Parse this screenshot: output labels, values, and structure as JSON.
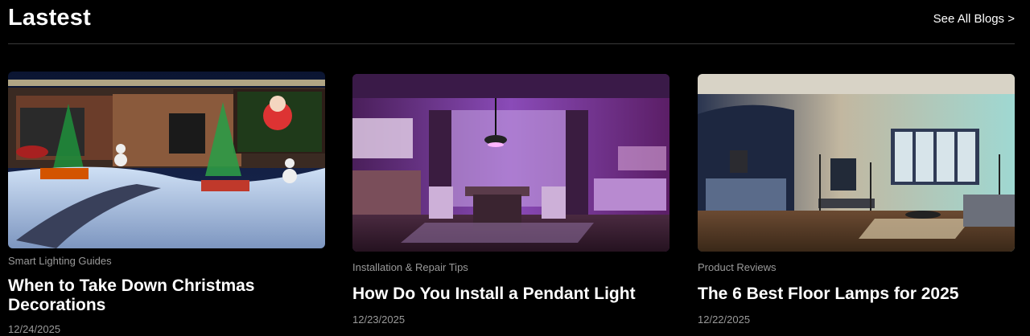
{
  "section": {
    "title": "Lastest",
    "see_all": "See All Blogs >"
  },
  "cards": [
    {
      "category": "Smart Lighting Guides",
      "title": "When to Take Down Christmas Decorations",
      "date": "12/24/2025"
    },
    {
      "category": "Installation & Repair Tips",
      "title": "How Do You Install a Pendant Light",
      "date": "12/23/2025"
    },
    {
      "category": "Product Reviews",
      "title": "The 6 Best Floor Lamps for 2025",
      "date": "12/22/2025"
    }
  ],
  "colors": {
    "background": "#000000",
    "muted_text": "#9a9a9a",
    "divider": "#3a3a3a"
  }
}
